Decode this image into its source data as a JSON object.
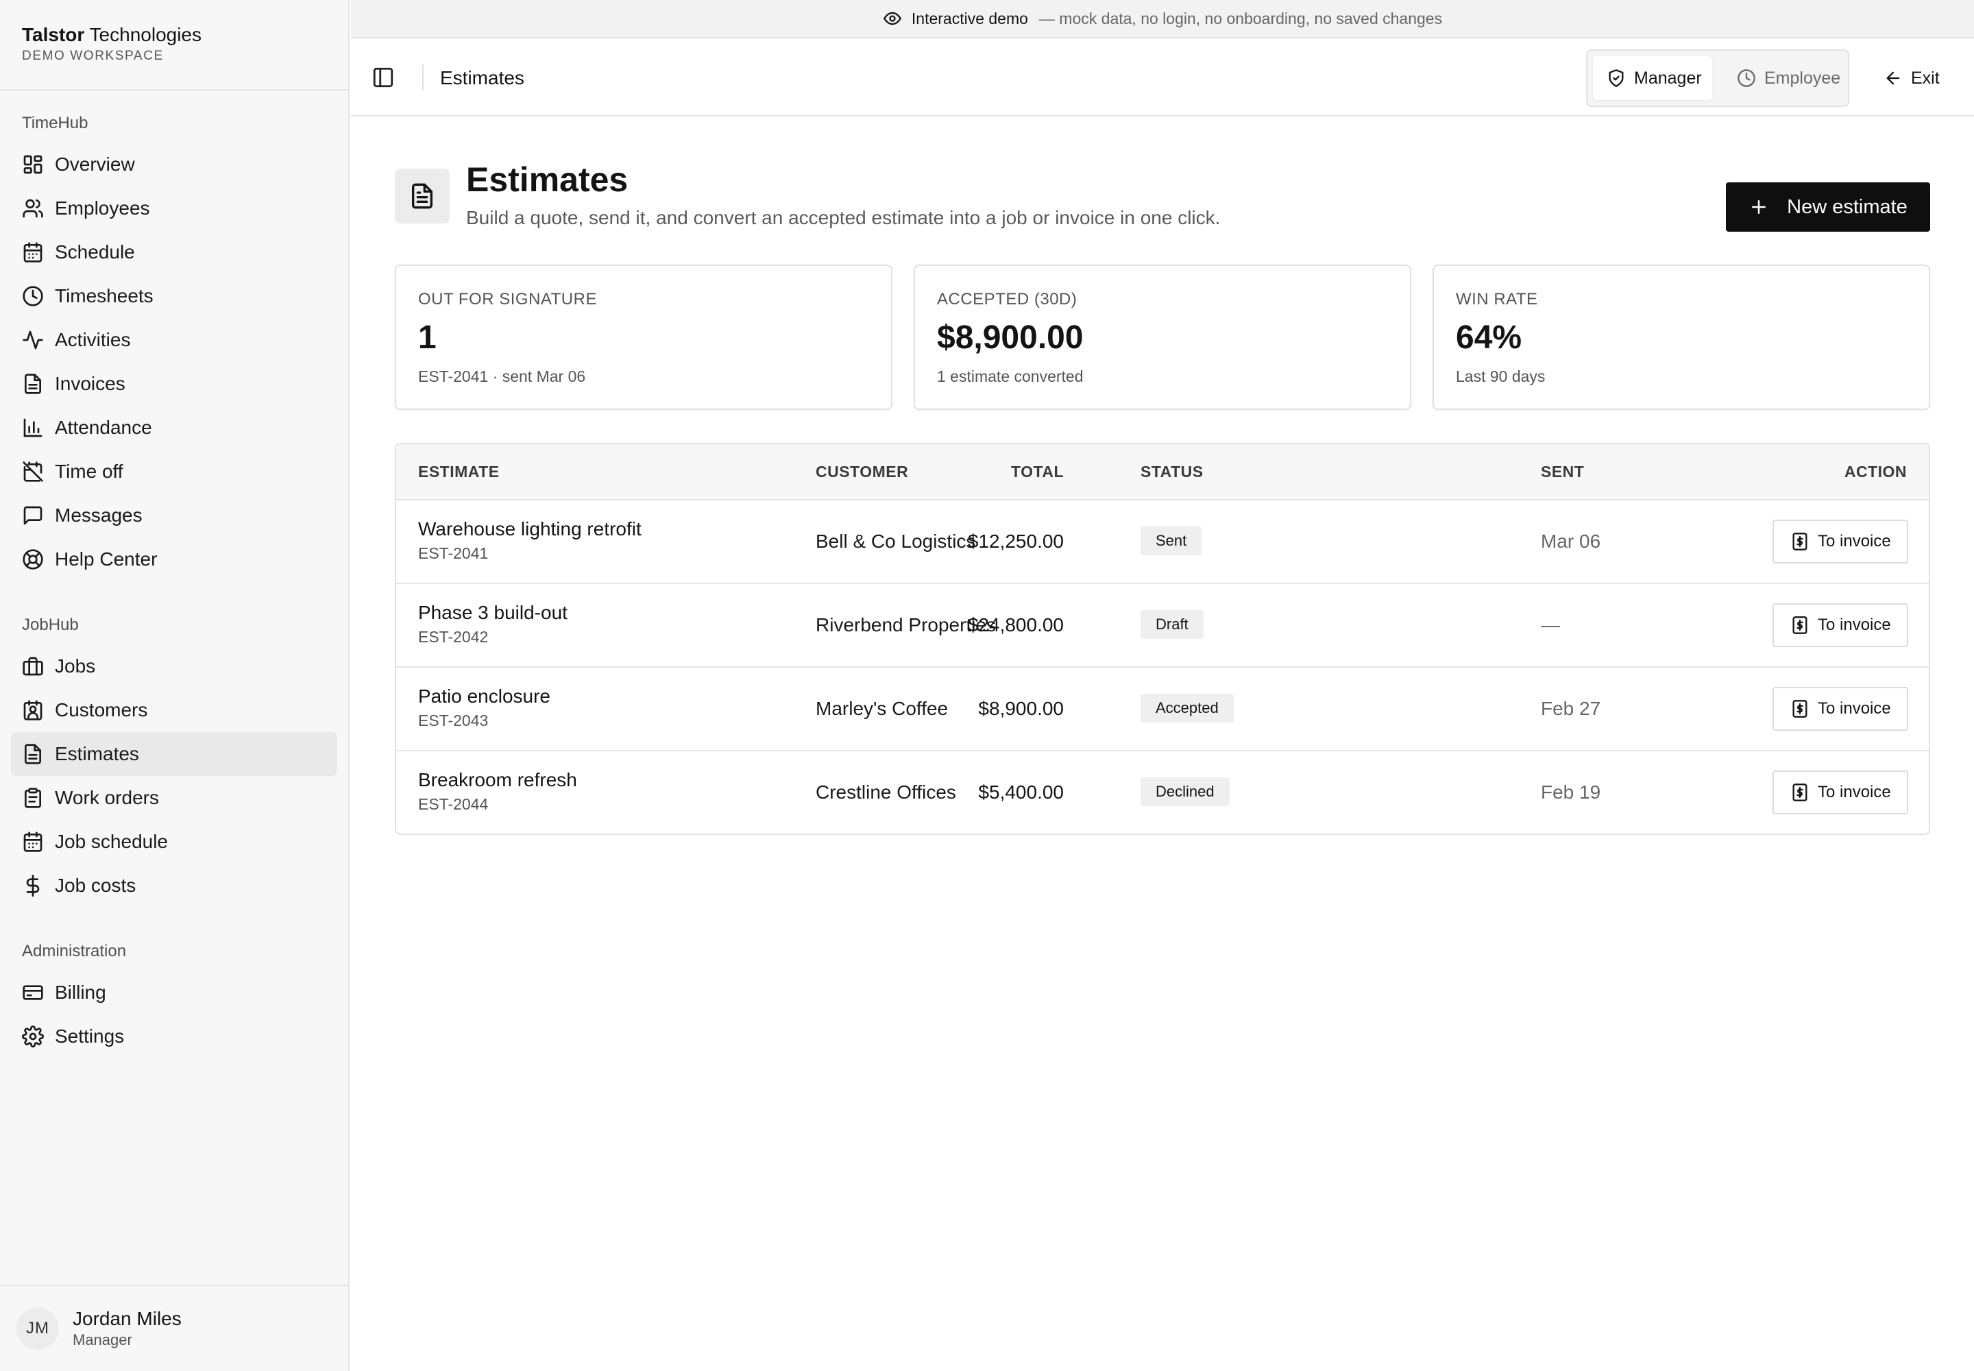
{
  "banner": {
    "label": "Interactive demo",
    "note": "— mock data, no login, no onboarding, no saved changes"
  },
  "brand": {
    "name_bold": "Talstor",
    "name_rest": " Technologies",
    "workspace": "DEMO WORKSPACE"
  },
  "sidebar": {
    "sections": [
      {
        "title": "TimeHub",
        "items": [
          {
            "label": "Overview",
            "icon": "dashboard-icon"
          },
          {
            "label": "Employees",
            "icon": "users-icon"
          },
          {
            "label": "Schedule",
            "icon": "calendar-icon"
          },
          {
            "label": "Timesheets",
            "icon": "clock-icon"
          },
          {
            "label": "Activities",
            "icon": "activity-icon"
          },
          {
            "label": "Invoices",
            "icon": "file-icon"
          },
          {
            "label": "Attendance",
            "icon": "bar-chart-icon"
          },
          {
            "label": "Time off",
            "icon": "calendar-off-icon"
          },
          {
            "label": "Messages",
            "icon": "message-icon"
          },
          {
            "label": "Help Center",
            "icon": "lifebuoy-icon"
          }
        ]
      },
      {
        "title": "JobHub",
        "items": [
          {
            "label": "Jobs",
            "icon": "briefcase-icon"
          },
          {
            "label": "Customers",
            "icon": "contact-icon"
          },
          {
            "label": "Estimates",
            "icon": "file-icon",
            "active": true
          },
          {
            "label": "Work orders",
            "icon": "clipboard-icon"
          },
          {
            "label": "Job schedule",
            "icon": "calendar-icon"
          },
          {
            "label": "Job costs",
            "icon": "dollar-icon"
          }
        ]
      },
      {
        "title": "Administration",
        "items": [
          {
            "label": "Billing",
            "icon": "credit-card-icon"
          },
          {
            "label": "Settings",
            "icon": "gear-icon"
          }
        ]
      }
    ]
  },
  "user": {
    "initials": "JM",
    "name": "Jordan Miles",
    "role": "Manager"
  },
  "topbar": {
    "title": "Estimates",
    "role_manager": "Manager",
    "role_employee": "Employee",
    "exit": "Exit"
  },
  "page": {
    "title": "Estimates",
    "subtitle": "Build a quote, send it, and convert an accepted estimate into a job or invoice in one click.",
    "new_button": "New estimate"
  },
  "stats": [
    {
      "label": "OUT FOR SIGNATURE",
      "value": "1",
      "note": "EST-2041 · sent Mar 06"
    },
    {
      "label": "ACCEPTED (30D)",
      "value": "$8,900.00",
      "note": "1 estimate converted"
    },
    {
      "label": "WIN RATE",
      "value": "64%",
      "note": "Last 90 days"
    }
  ],
  "table": {
    "headers": {
      "estimate": "ESTIMATE",
      "customer": "CUSTOMER",
      "status": "STATUS",
      "total": "TOTAL",
      "sent": "SENT",
      "action": "ACTION"
    },
    "rows": [
      {
        "title": "Warehouse lighting retrofit",
        "id": "EST-2041",
        "customer": "Bell & Co Logistics",
        "status": "Sent",
        "total": "$12,250.00",
        "sent": "Mar 06",
        "action": "To invoice"
      },
      {
        "title": "Phase 3 build-out",
        "id": "EST-2042",
        "customer": "Riverbend Properties",
        "status": "Draft",
        "total": "$24,800.00",
        "sent": "—",
        "action": "To invoice"
      },
      {
        "title": "Patio enclosure",
        "id": "EST-2043",
        "customer": "Marley's Coffee",
        "status": "Accepted",
        "total": "$8,900.00",
        "sent": "Feb 27",
        "action": "To invoice"
      },
      {
        "title": "Breakroom refresh",
        "id": "EST-2044",
        "customer": "Crestline Offices",
        "status": "Declined",
        "total": "$5,400.00",
        "sent": "Feb 19",
        "action": "To invoice"
      }
    ]
  }
}
